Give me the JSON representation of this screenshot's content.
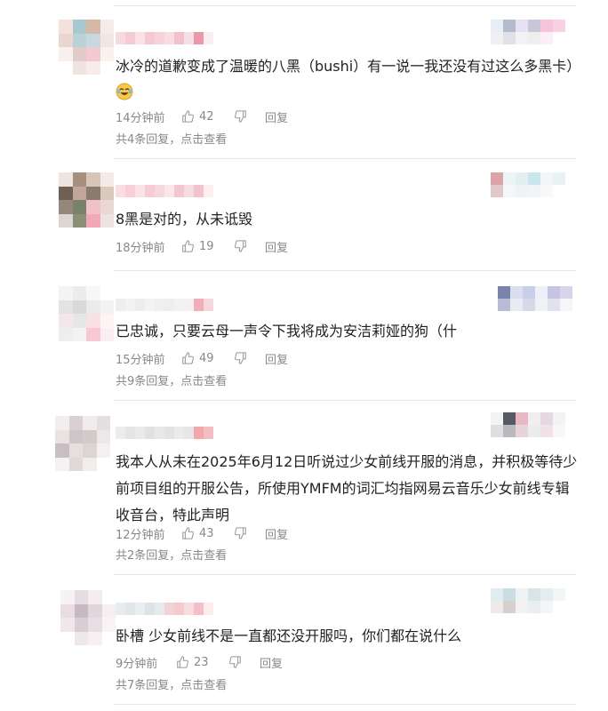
{
  "comments": [
    {
      "text": "冰冷的道歉变成了温暖的八黑（bushi）有一说一我还没有过这么多黑卡）",
      "has_emoji": true,
      "time": "14分钟前",
      "likes": "42",
      "reply_label": "回复",
      "more_replies": "共4条回复，点击查看",
      "avatar_colors": [
        "#f3e2dc",
        "#a9c7cf",
        "#d8b9a8",
        "#f4ece8",
        "#e9d7cf",
        "#b8d2d8",
        "#c8d8e0",
        "#f1e6e0",
        "#f7f0ed",
        "#e0ccc8",
        "#f3c8d3",
        "#fbf2f0",
        "#ffffff",
        "#f0e4e0",
        "#f7ecea",
        "#ffffff"
      ],
      "name_colors": [
        "#f8d9e0",
        "#f5cbd5",
        "#f9e1e7",
        "#f3c9d2",
        "#f6d3db",
        "#f9dde3",
        "#f1c1cc",
        "#f6e0e6",
        "#e89aa8",
        "#fbeef1"
      ],
      "thumb_colors": [
        "#e7eef5",
        "#b4bccb",
        "#e8dff0",
        "#c9c6d8",
        "#f7c4dc",
        "#f8d2e3",
        "#f0f0f4",
        "#e0e0e8",
        "#f3f3f6",
        "#eeeeef",
        "#fbeef4",
        "#ffffff"
      ]
    },
    {
      "text": "8黑是对的，从未诋毁",
      "has_emoji": false,
      "time": "18分钟前",
      "likes": "19",
      "reply_label": "回复",
      "more_replies": "",
      "avatar_colors": [
        "#efe5df",
        "#a78f80",
        "#d7c6b8",
        "#f4ebe6",
        "#6f5f54",
        "#c0a79a",
        "#8b7a6f",
        "#dbc9bd",
        "#93877b",
        "#788268",
        "#f0c1c9",
        "#e9d9d2",
        "#dcd6d0",
        "#8a8f76",
        "#f2a8b8",
        "#ede4df"
      ],
      "name_colors": [
        "#f9dde3",
        "#f6cfd8",
        "#f9e3e8",
        "#f5ccd6",
        "#f7d7de",
        "#fae6eb",
        "#f3c6d0",
        "#f6dce2",
        "#f2c3cd",
        "#fbeff2"
      ],
      "thumb_colors": [
        "#d9a4a8",
        "#edf4f5",
        "#e3eff1",
        "#c9e6ec",
        "#f2f6f7",
        "#e8f2f4",
        "#e0c8cb",
        "#f4f7f8",
        "#eef3f5",
        "#f1f5f6",
        "#f7f9fa",
        "#ffffff"
      ]
    },
    {
      "text": "已忠诚，只要云母一声令下我将成为安洁莉娅的狗（什",
      "has_emoji": false,
      "time": "15分钟前",
      "likes": "49",
      "reply_label": "回复",
      "more_replies": "共9条回复，点击查看",
      "avatar_colors": [
        "#f4f4f4",
        "#ececec",
        "#f7f7f7",
        "#ffffff",
        "#e3e3e3",
        "#d9d9d9",
        "#ebebeb",
        "#f2f2f2",
        "#f5e6ea",
        "#e6e6e6",
        "#f9dfe6",
        "#fff3f6",
        "#eeeeee",
        "#f3f3f3",
        "#f7c7d5",
        "#fbeef2"
      ],
      "name_colors": [
        "#eeeeef",
        "#f2f2f3",
        "#ededee",
        "#f3f3f4",
        "#f0f0f1",
        "#eeeeef",
        "#f2f2f3",
        "#f4f0f1",
        "#f2aeb8",
        "#f6d7dd"
      ],
      "thumb_colors": [
        "#7a84ab",
        "#dadff0",
        "#c9cfe6",
        "#eef0f7",
        "#c7c3e0",
        "#d7d5ea",
        "#b7bdd6",
        "#e9ebf4",
        "#d5d9ea",
        "#eff1f7",
        "#e2e2ef",
        "#f5f5fa"
      ]
    },
    {
      "text": "我本人从未在2025年6月12日听说过少女前线开服的消息，并积极等待少前项目组的开服公告，所使用YMFM的词汇均指网易云音乐少女前线专辑收音台，特此声明",
      "has_emoji": false,
      "time": "12分钟前",
      "likes": "43",
      "reply_label": "回复",
      "more_replies": "共2条回复，点击查看",
      "avatar_colors": [
        "#f2eeee",
        "#d8d0d2",
        "#f1ecec",
        "#e5dede",
        "#e8e2e3",
        "#cfc6c8",
        "#d4cacc",
        "#ede8e8",
        "#c9bfc2",
        "#e6dfe0",
        "#dcd5d6",
        "#f4f0f0",
        "#f5f2f2",
        "#e0d9da",
        "#f1eded",
        "#ffffff"
      ],
      "name_colors": [
        "#ececec",
        "#e4e4e4",
        "#eaeaea",
        "#e1e1e1",
        "#e8e8e8",
        "#e3e3e3",
        "#ebebeb",
        "#e6e6e6",
        "#f1a7ae",
        "#f4bcc3"
      ],
      "thumb_colors": [
        "#f3f3f3",
        "#585a63",
        "#e9b6c4",
        "#f2eef0",
        "#e5d8de",
        "#f3f3f3",
        "#dfdfe0",
        "#b8b8bd",
        "#e7d4db",
        "#ececef",
        "#f0e2e8",
        "#f7f7f8"
      ]
    },
    {
      "text": "卧槽 少女前线不是一直都还没开服吗，你们都在说什么",
      "has_emoji": false,
      "time": "9分钟前",
      "likes": "23",
      "reply_label": "回复",
      "more_replies": "共7条回复，点击查看",
      "avatar_colors": [
        "#f7f2f3",
        "#e6dde2",
        "#f4ecef",
        "#ffffff",
        "#e9dde3",
        "#c7b9c4",
        "#e3d5dc",
        "#f6eff2",
        "#efe7ea",
        "#d9cdd4",
        "#e8dde2",
        "#f8f3f5",
        "#ffffff",
        "#efe8eb",
        "#f6f0f2",
        "#ffffff"
      ],
      "name_colors": [
        "#e8ecee",
        "#e1e6e9",
        "#e9eef0",
        "#dde3e6",
        "#e5eaec",
        "#f1d2d6",
        "#f5c9ce",
        "#f8dde0",
        "#f2c0c6",
        "#fbecee"
      ],
      "thumb_colors": [
        "#e0ecef",
        "#c9dde3",
        "#eef2f3",
        "#d7e4e8",
        "#e4eef1",
        "#f2f6f7",
        "#f0e9ea",
        "#d8cfd1",
        "#f4f1f2",
        "#e9eef0",
        "#f3f6f7",
        "#ffffff"
      ]
    }
  ]
}
